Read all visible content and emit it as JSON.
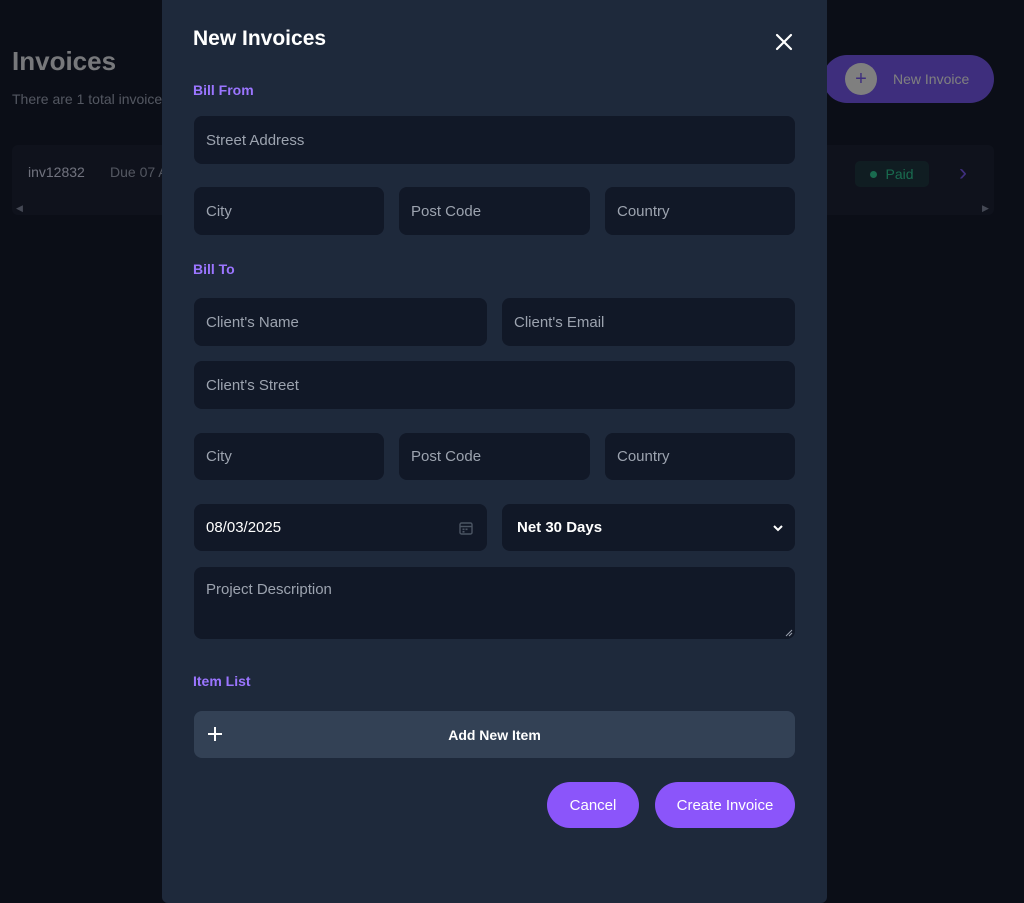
{
  "background": {
    "title": "Invoices",
    "subtitle": "There are 1 total invoice",
    "new_invoice_label": "New Invoice",
    "new_invoice_icon": "+",
    "invoice_row": {
      "id": "inv12832",
      "due": "Due 07 A",
      "status": "Paid"
    },
    "row_chevron": "›"
  },
  "modal": {
    "title": "New Invoices",
    "bill_from": {
      "label": "Bill From",
      "street_placeholder": "Street Address",
      "city_placeholder": "City",
      "postcode_placeholder": "Post Code",
      "country_placeholder": "Country"
    },
    "bill_to": {
      "label": "Bill To",
      "client_name_placeholder": "Client's Name",
      "client_email_placeholder": "Client's Email",
      "client_street_placeholder": "Client's Street",
      "city_placeholder": "City",
      "postcode_placeholder": "Post Code",
      "country_placeholder": "Country"
    },
    "invoice_date": "08/03/2025",
    "payment_terms": {
      "selected": "Net 30 Days"
    },
    "project_description_placeholder": "Project Description",
    "item_list": {
      "label": "Item List",
      "add_item_label": "Add New Item"
    },
    "cancel_label": "Cancel",
    "create_label": "Create Invoice"
  },
  "colors": {
    "accent": "#8b55fa",
    "section_label": "#9b75ff",
    "modal_bg": "#1e293b",
    "field_bg": "#111827",
    "add_item_bg": "#334155",
    "paid": "#33d69f"
  }
}
